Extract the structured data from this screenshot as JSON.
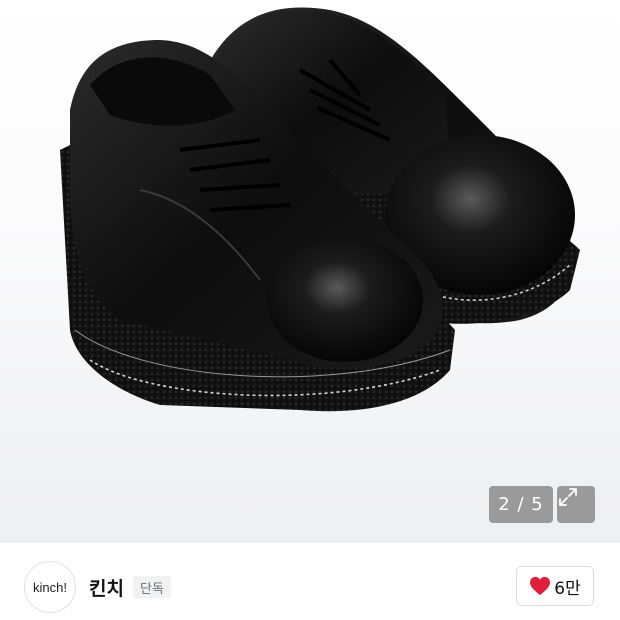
{
  "gallery": {
    "current": "2",
    "separator": "/",
    "total": "5",
    "counter_text": "2 / 5",
    "expand_icon": "expand-arrows-icon"
  },
  "shop": {
    "avatar_text": "kinch!",
    "name": "킨치",
    "badge": "단독"
  },
  "like": {
    "icon": "heart-icon",
    "color": "#e0203b",
    "count": "6만"
  }
}
